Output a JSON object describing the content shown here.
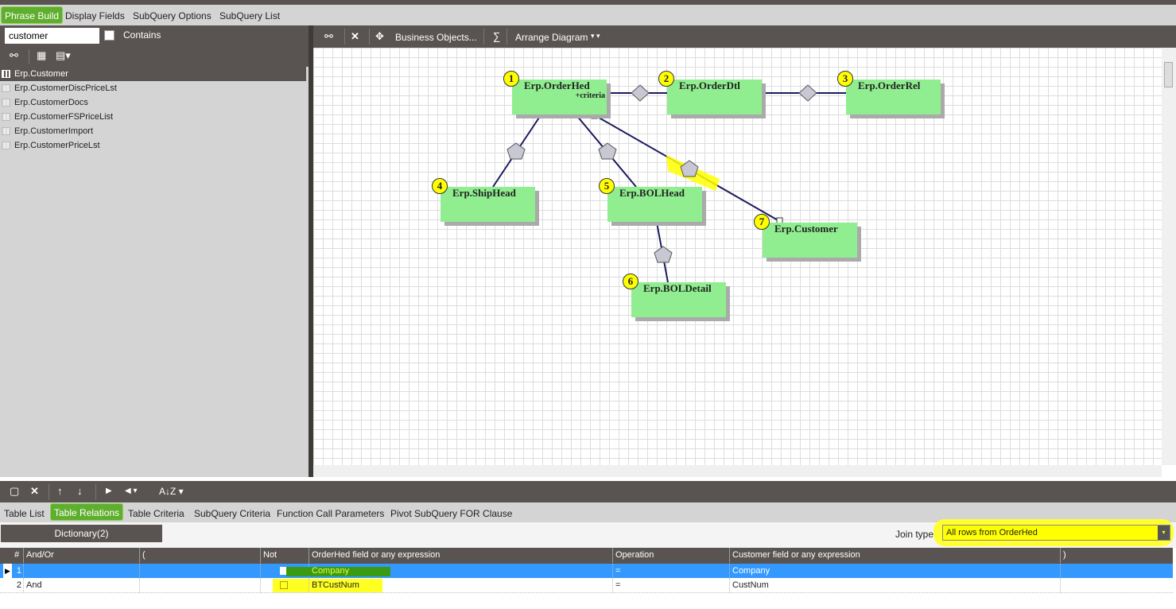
{
  "top_tabs": [
    {
      "label": "Phrase Build",
      "active": true
    },
    {
      "label": "Display Fields"
    },
    {
      "label": "SubQuery Options"
    },
    {
      "label": "SubQuery List"
    }
  ],
  "search": {
    "value": "customer",
    "contains_label": "Contains",
    "contains_checked": false
  },
  "table_list": [
    "Erp.Customer",
    "Erp.CustomerDiscPriceLst",
    "Erp.CustomerDocs",
    "Erp.CustomerFSPriceList",
    "Erp.CustomerImport",
    "Erp.CustomerPriceLst"
  ],
  "diagram_toolbar": {
    "business_objects": "Business Objects...",
    "sigma": "∑",
    "arrange": "Arrange Diagram"
  },
  "diagram": {
    "nodes": [
      {
        "n": "1",
        "name": "Erp.OrderHed",
        "note": "+criteria"
      },
      {
        "n": "2",
        "name": "Erp.OrderDtl"
      },
      {
        "n": "3",
        "name": "Erp.OrderRel"
      },
      {
        "n": "4",
        "name": "Erp.ShipHead"
      },
      {
        "n": "5",
        "name": "Erp.BOLHead"
      },
      {
        "n": "6",
        "name": "Erp.BOLDetail"
      },
      {
        "n": "7",
        "name": "Erp.Customer"
      }
    ],
    "node_color": "#90ee90",
    "line_color": "#1a1a5e",
    "highlight": "#ffff00"
  },
  "bottom_tabs": [
    {
      "label": "Table List"
    },
    {
      "label": "Table Relations",
      "active": true
    },
    {
      "label": "Table Criteria"
    },
    {
      "label": "SubQuery Criteria"
    },
    {
      "label": "Function Call Parameters"
    },
    {
      "label": "Pivot SubQuery FOR Clause"
    }
  ],
  "dictionary_label": "Dictionary(2)",
  "join": {
    "label": "Join type:",
    "value": "All rows from OrderHed"
  },
  "grid": {
    "columns": [
      "#",
      "And/Or",
      "(",
      "Not",
      "OrderHed field or any expression",
      "Operation",
      "Customer field or any expression",
      ")"
    ],
    "rows": [
      [
        "1",
        "",
        "",
        "",
        "Company",
        "=",
        "Company",
        ""
      ],
      [
        "2",
        "And",
        "",
        "",
        "BTCustNum",
        "=",
        "CustNum",
        ""
      ]
    ]
  },
  "colors": {
    "accent": "#5fae2e",
    "selection": "#3399ff",
    "toolbar": "#595451"
  }
}
